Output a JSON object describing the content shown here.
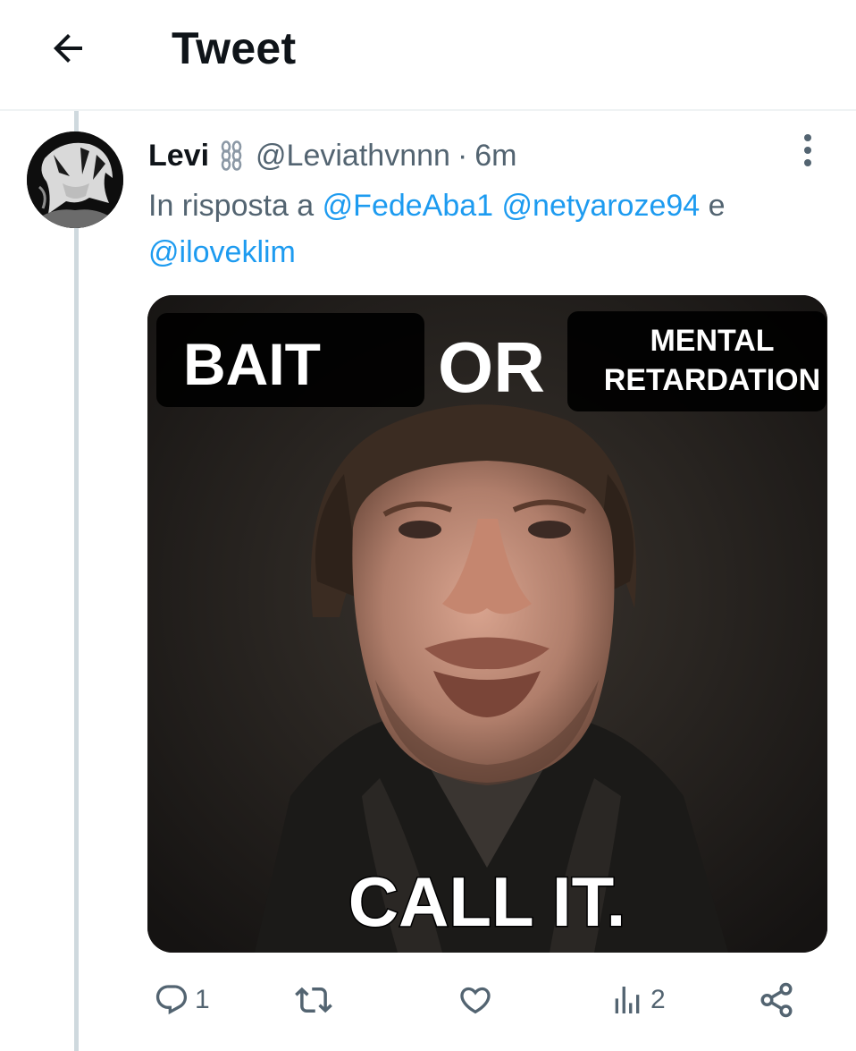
{
  "header": {
    "title": "Tweet",
    "back_icon": "arrow-left-icon"
  },
  "tweet": {
    "author": {
      "display_name": "Levi",
      "name_badge_icon": "chain-link-icon",
      "handle": "@Leviathvnnn",
      "separator": "·",
      "time": "6m"
    },
    "reply_prefix": "In risposta a",
    "mentions": [
      "@FedeAba1",
      "@netyaroze94",
      "@iloveklim"
    ],
    "reply_conjunction": "e",
    "media": {
      "caption_left": "BAIT",
      "caption_middle": "OR",
      "caption_right_line1": "MENTAL",
      "caption_right_line2": "RETARDATION",
      "caption_bottom": "CALL IT."
    },
    "actions": {
      "replies": "1",
      "retweets": "",
      "likes": "",
      "views": "2"
    }
  },
  "colors": {
    "text": "#0f1419",
    "secondary": "#536471",
    "link": "#1d9bf0",
    "divider": "#eff3f4",
    "thread": "#cfd9de"
  }
}
